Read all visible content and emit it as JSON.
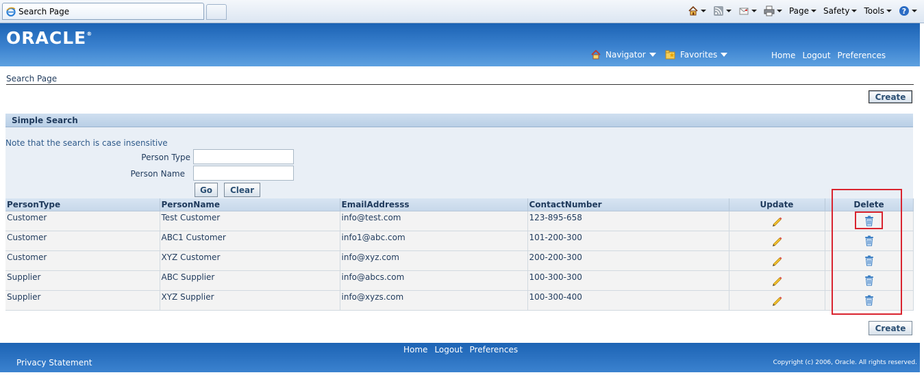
{
  "browser": {
    "tab_title": "Search Page",
    "menus": {
      "page": "Page",
      "safety": "Safety",
      "tools": "Tools"
    },
    "icons": [
      "home-icon",
      "feeds-icon",
      "mail-icon",
      "print-icon",
      "help-icon"
    ]
  },
  "header": {
    "logo": "ORACLE",
    "logo_mark": "®",
    "navigator": "Navigator",
    "favorites": "Favorites",
    "links": {
      "home": "Home",
      "logout": "Logout",
      "preferences": "Preferences"
    }
  },
  "page": {
    "title": "Search Page",
    "create_label": "Create"
  },
  "search": {
    "header": "Simple Search",
    "note": "Note that the search is case insensitive",
    "person_type_label": "Person Type",
    "person_type_value": "",
    "person_name_label": "Person Name",
    "person_name_value": "",
    "go_label": "Go",
    "clear_label": "Clear"
  },
  "table": {
    "columns": {
      "person_type": "PersonType",
      "person_name": "PersonName",
      "email": "EmailAddresss",
      "contact": "ContactNumber",
      "update": "Update",
      "delete": "Delete"
    },
    "rows": [
      {
        "person_type": "Customer",
        "person_name": "Test Customer",
        "email": "info@test.com",
        "contact": "123-895-658"
      },
      {
        "person_type": "Customer",
        "person_name": "ABC1 Customer",
        "email": "info1@abc.com",
        "contact": "101-200-300"
      },
      {
        "person_type": "Customer",
        "person_name": "XYZ Customer",
        "email": "info@xyz.com",
        "contact": "200-200-300"
      },
      {
        "person_type": "Supplier",
        "person_name": "ABC Supplier",
        "email": "info@abcs.com",
        "contact": "100-300-300"
      },
      {
        "person_type": "Supplier",
        "person_name": "XYZ Supplier",
        "email": "info@xyzs.com",
        "contact": "100-300-400"
      }
    ]
  },
  "footer": {
    "links": {
      "home": "Home",
      "logout": "Logout",
      "preferences": "Preferences"
    },
    "privacy": "Privacy Statement",
    "copyright": "Copyright (c) 2006, Oracle. All rights reserved."
  },
  "colors": {
    "header_blue": "#1c63b4",
    "highlight_red": "#d9232e",
    "label_navy": "#1f3a5c"
  }
}
